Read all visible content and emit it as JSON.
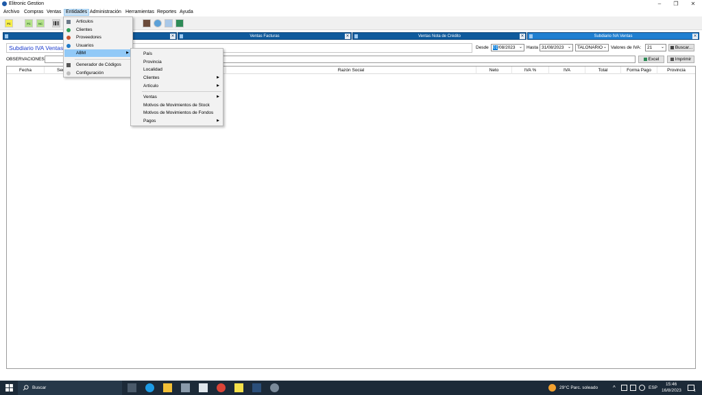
{
  "window": {
    "title": "Elitronic Gestion",
    "controls": {
      "minimize": "–",
      "maximize": "❐",
      "close": "✕"
    }
  },
  "menubar": {
    "items": [
      "Archivo",
      "Compras",
      "Ventas",
      "Entidades",
      "Administración",
      "Herramientas",
      "Reportes",
      "Ayuda"
    ],
    "active": "Entidades"
  },
  "toolbar": {
    "buttons": [
      {
        "label": "FC",
        "icon": "invoice-icon"
      },
      {
        "label": "FC",
        "icon": "invoice-icon"
      },
      {
        "label": "NC",
        "icon": "credit-note-icon"
      },
      {
        "label": "",
        "icon": "barcode-icon"
      },
      {
        "label": "",
        "icon": "box-icon"
      },
      {
        "label": "",
        "icon": "globe-icon"
      },
      {
        "label": "",
        "icon": "calculator-icon"
      },
      {
        "label": "",
        "icon": "excel-icon"
      }
    ]
  },
  "tabs": [
    {
      "label": "",
      "active": false
    },
    {
      "label": "Ventas Facturas",
      "active": false
    },
    {
      "label": "Ventas Nota de Crédito",
      "active": false
    },
    {
      "label": "Subdiario IVA Ventas",
      "active": true
    }
  ],
  "filters": {
    "page_title": "Subdiario IVA Ventas",
    "desde_label": "Desde",
    "desde_value_sel": "01",
    "desde_value_rest": "/08/2023",
    "hasta_label": "Hasta",
    "hasta_value": "31/08/2023",
    "tipo_value": "TALONARIO",
    "valores_label": "Valores de IVA:",
    "valores_value": "21",
    "buscar_label": "Buscar...",
    "excel_label": "Excel",
    "imprimir_label": "Imprimir"
  },
  "observaciones": {
    "label": "OBSERVACIONES:",
    "value": ""
  },
  "grid": {
    "columns": [
      "Fecha",
      "Ser",
      "",
      "Razón Social",
      "Neto",
      "IVA %",
      "IVA",
      "Total",
      "Forma Pago",
      "Provincia"
    ]
  },
  "entidades_menu": {
    "items": [
      {
        "label": "Articulos",
        "icon": "articles-icon",
        "submenu": false
      },
      {
        "label": "Clientes",
        "icon": "clients-icon",
        "submenu": false
      },
      {
        "label": "Proveedores",
        "icon": "suppliers-icon",
        "submenu": false
      },
      {
        "label": "Usuarios",
        "icon": "users-icon",
        "submenu": false
      },
      {
        "label": "ABM",
        "icon": "",
        "submenu": true,
        "highlighted": true
      },
      {
        "label": "Generador de Códigos",
        "icon": "barcode-icon",
        "submenu": false
      },
      {
        "label": "Configuración",
        "icon": "gear-icon",
        "submenu": false
      }
    ]
  },
  "abm_menu": {
    "items": [
      {
        "label": "País",
        "submenu": false
      },
      {
        "label": "Provincia",
        "submenu": false
      },
      {
        "label": "Localidad",
        "submenu": false
      },
      {
        "label": "Clientes",
        "submenu": true
      },
      {
        "label": "Artículo",
        "submenu": true
      },
      {
        "label": "Ventas",
        "submenu": true
      },
      {
        "label": "Motivos de Movimientos de Stock",
        "submenu": false
      },
      {
        "label": "Motivos de  Movimientos de Fondos",
        "submenu": false
      },
      {
        "label": "Pagos",
        "submenu": true
      }
    ]
  },
  "taskbar": {
    "search_placeholder": "Buscar",
    "weather": "29°C  Parc. soleado",
    "language": "ESP",
    "time": "15:46",
    "date": "16/8/2023",
    "notification_count": "1"
  },
  "colors": {
    "tab_bg": "#0f5a9c",
    "active_tab_bg": "#1f7fd1",
    "title_text": "#1a3acd",
    "menu_highlight": "#91c9f7",
    "taskbar_bg": "#1c2a38"
  }
}
